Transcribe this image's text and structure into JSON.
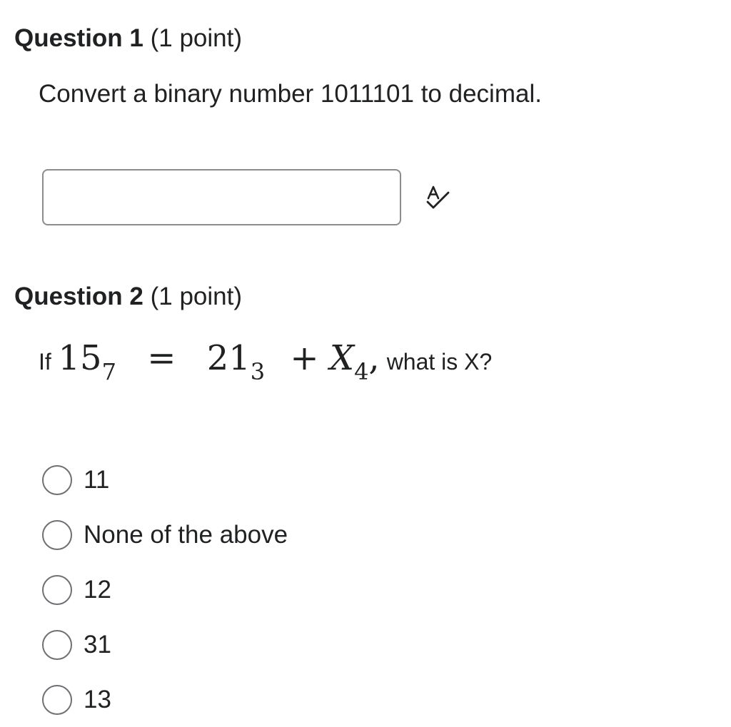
{
  "question1": {
    "heading": "Question 1",
    "points": "(1 point)",
    "prompt": "Convert a binary number 1011101 to decimal.",
    "answer_value": "",
    "icon": "spellcheck-icon"
  },
  "question2": {
    "heading": "Question 2",
    "points": "(1 point)",
    "prompt_lead": "If",
    "math": {
      "term1": "15",
      "base1": "7",
      "equals": "=",
      "term2": "21",
      "base2": "3",
      "plus": "+",
      "term3": "X",
      "base3": "4",
      "comma": ","
    },
    "prompt_tail": "what is X?",
    "options": [
      {
        "label": "11",
        "selected": false
      },
      {
        "label": "None of the above",
        "selected": false
      },
      {
        "label": "12",
        "selected": false
      },
      {
        "label": "31",
        "selected": false
      },
      {
        "label": "13",
        "selected": false
      }
    ]
  },
  "colors": {
    "text": "#202122",
    "input_border": "#8a8c8e",
    "radio_border": "#6e7073"
  }
}
